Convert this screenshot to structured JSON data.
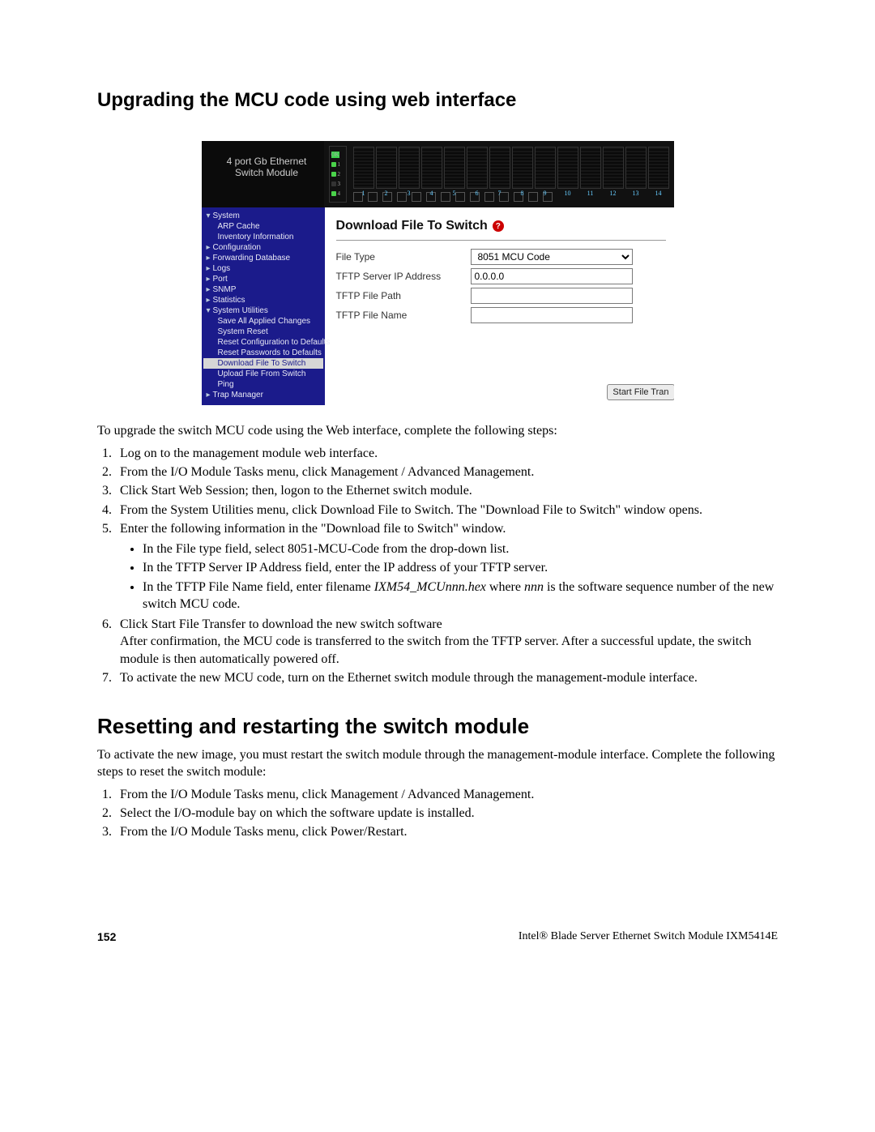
{
  "heading1": "Upgrading the MCU code using web interface",
  "screenshot": {
    "product_label_line1": "4 port Gb Ethernet",
    "product_label_line2": "Switch Module",
    "ok_label": "OK",
    "slot_numbers": [
      "1",
      "2",
      "3",
      "4",
      "5",
      "6",
      "7",
      "8",
      "9",
      "10",
      "11",
      "12",
      "13",
      "14"
    ],
    "sidebar": {
      "items": [
        {
          "arrow": "▾",
          "label": "System",
          "lev": 0
        },
        {
          "arrow": "",
          "label": "ARP Cache",
          "lev": 1
        },
        {
          "arrow": "",
          "label": "Inventory Information",
          "lev": 1
        },
        {
          "arrow": "▸",
          "label": "Configuration",
          "lev": 0
        },
        {
          "arrow": "▸",
          "label": "Forwarding Database",
          "lev": 0
        },
        {
          "arrow": "▸",
          "label": "Logs",
          "lev": 0
        },
        {
          "arrow": "▸",
          "label": "Port",
          "lev": 0
        },
        {
          "arrow": "▸",
          "label": "SNMP",
          "lev": 0
        },
        {
          "arrow": "▸",
          "label": "Statistics",
          "lev": 0
        },
        {
          "arrow": "▾",
          "label": "System Utilities",
          "lev": 0
        },
        {
          "arrow": "",
          "label": "Save All Applied Changes",
          "lev": 1
        },
        {
          "arrow": "",
          "label": "System Reset",
          "lev": 1
        },
        {
          "arrow": "",
          "label": "Reset Configuration to Defaults",
          "lev": 1
        },
        {
          "arrow": "",
          "label": "Reset Passwords to Defaults",
          "lev": 1
        },
        {
          "arrow": "",
          "label": "Download File To Switch",
          "lev": 1,
          "selected": true
        },
        {
          "arrow": "",
          "label": "Upload File From Switch",
          "lev": 1
        },
        {
          "arrow": "",
          "label": "Ping",
          "lev": 1
        },
        {
          "arrow": "▸",
          "label": "Trap Manager",
          "lev": 0
        }
      ]
    },
    "main": {
      "title": "Download File To Switch",
      "help": "?",
      "labels": {
        "file_type": "File Type",
        "tftp_ip": "TFTP Server IP Address",
        "tftp_path": "TFTP File Path",
        "tftp_name": "TFTP File Name"
      },
      "values": {
        "file_type": "8051 MCU Code",
        "tftp_ip": "0.0.0.0",
        "tftp_path": "",
        "tftp_name": ""
      },
      "button": "Start File Tran"
    }
  },
  "intro": "To upgrade the switch MCU code using the Web interface, complete the following steps:",
  "steps1": [
    "Log on to the management module web interface.",
    "From the I/O Module Tasks menu, click Management / Advanced Management.",
    "Click Start Web Session; then, logon to the Ethernet switch module.",
    "From the System Utilities menu, click Download File to Switch. The \"Download File to Switch\" window opens.",
    "Enter the following information in the \"Download file to Switch\" window."
  ],
  "bullets": {
    "b1": "In the File type field, select 8051-MCU-Code from the drop-down list.",
    "b2": "In the TFTP Server IP Address field, enter the IP address of your TFTP server.",
    "b3_pre": "In the TFTP File Name field, enter filename ",
    "b3_ital": "IXM54_MCUnnn.hex",
    "b3_mid": " where ",
    "b3_ital2": "nnn",
    "b3_post": " is the software sequence number of the new switch MCU code."
  },
  "step6_a": "Click Start File Transfer to download the new switch software",
  "step6_b": "After confirmation, the MCU code is transferred to the switch from the TFTP server. After a successful update, the switch module is then automatically powered off.",
  "step7": "To activate the new MCU code, turn on the Ethernet switch module through the management-module interface.",
  "heading2": "Resetting and restarting the switch module",
  "intro2": "To activate the new image, you must restart the switch module through the management-module interface. Complete the following steps to reset the switch module:",
  "steps2": [
    "From the I/O Module Tasks menu, click Management / Advanced Management.",
    "Select the I/O-module bay on which the software update is installed.",
    "From the I/O Module Tasks menu, click Power/Restart."
  ],
  "footer": {
    "page": "152",
    "doc": "Intel® Blade Server Ethernet Switch Module IXM5414E"
  }
}
